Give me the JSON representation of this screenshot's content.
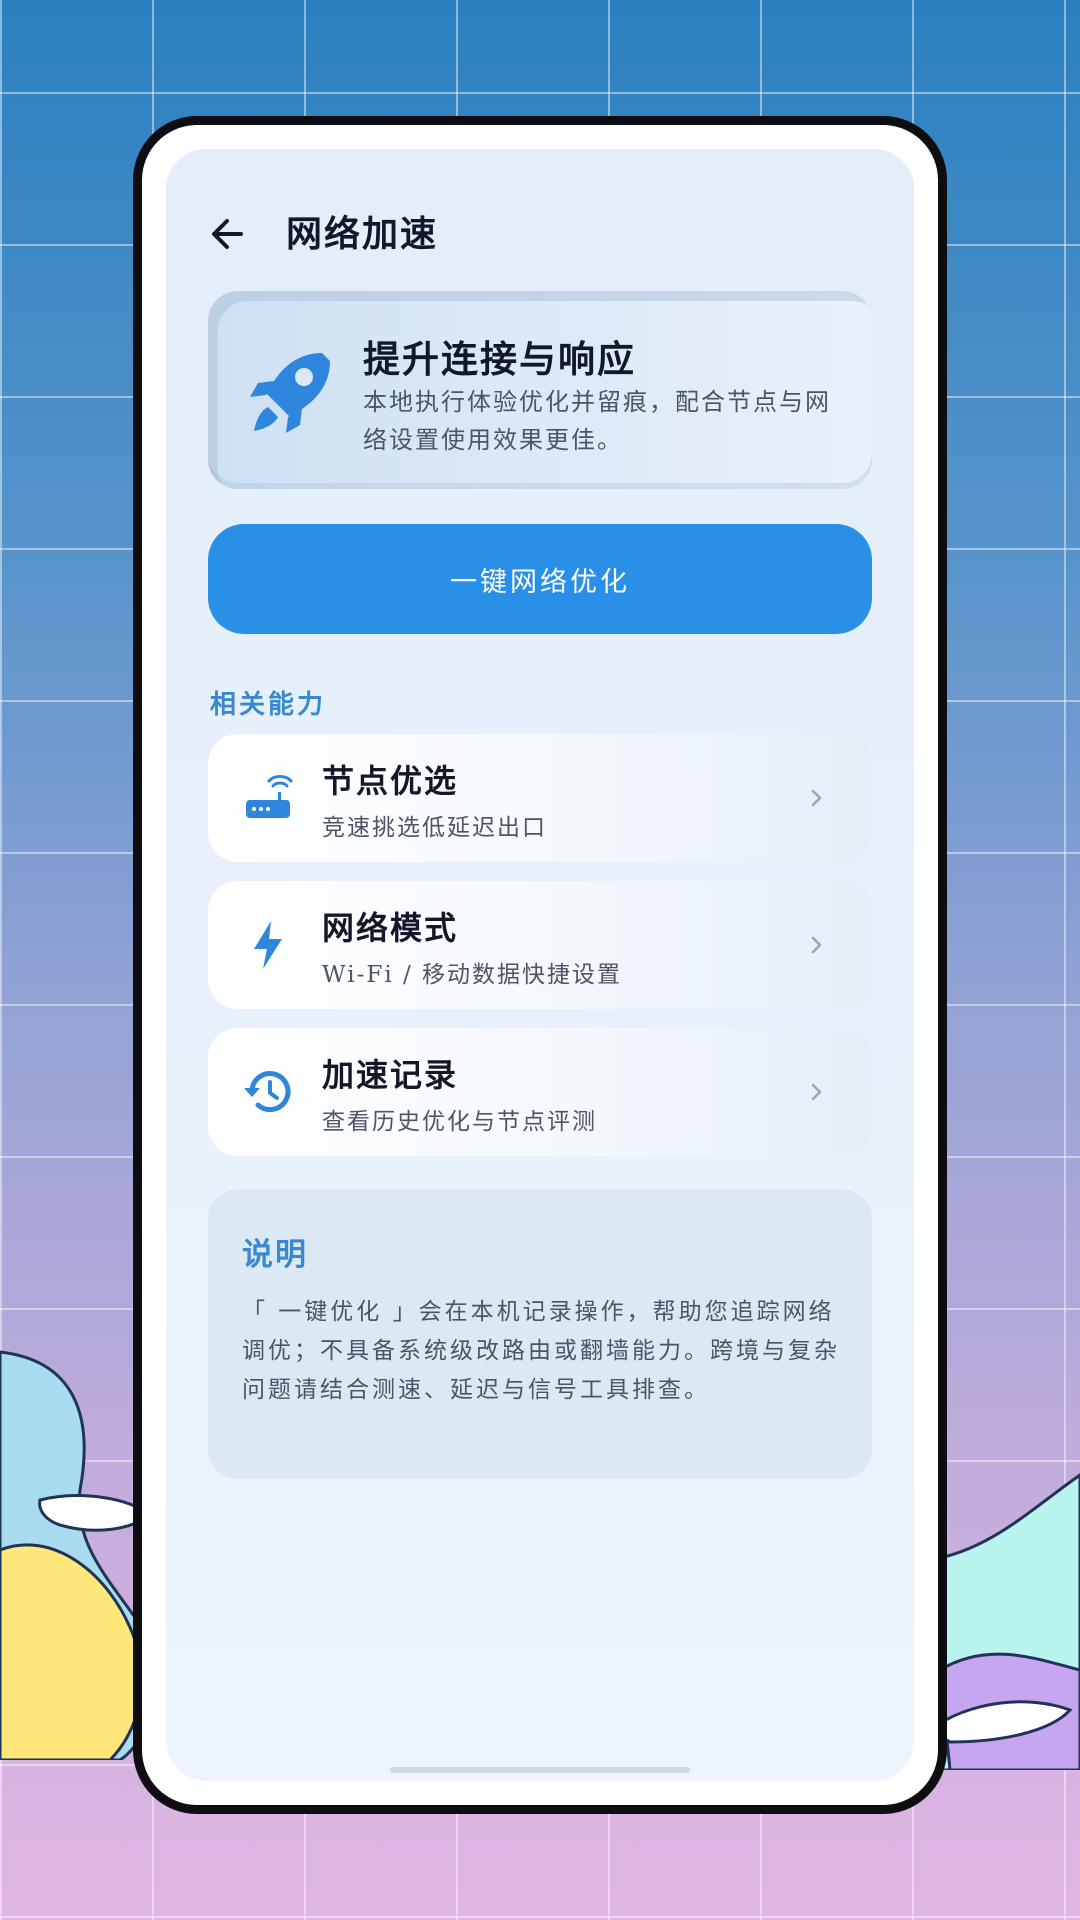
{
  "header": {
    "title": "网络加速",
    "back_icon": "arrow-left-icon"
  },
  "hero": {
    "icon": "rocket-icon",
    "title": "提升连接与响应",
    "description": "本地执行体验优化并留痕，配合节点与网络设置使用效果更佳。"
  },
  "primary_button": {
    "label": "一键网络优化"
  },
  "section": {
    "label": "相关能力"
  },
  "items": [
    {
      "icon": "router-wifi-icon",
      "title": "节点优选",
      "subtitle": "竞速挑选低延迟出口"
    },
    {
      "icon": "lightning-icon",
      "title": "网络模式",
      "subtitle": "Wi-Fi / 移动数据快捷设置"
    },
    {
      "icon": "history-clock-icon",
      "title": "加速记录",
      "subtitle": "查看历史优化与节点评测"
    }
  ],
  "note": {
    "title": "说明",
    "body": "「 一键优化 」会在本机记录操作，帮助您追踪网络调优；不具备系统级改路由或翻墙能力。跨境与复杂问题请结合测速、延迟与信号工具排查。"
  },
  "colors": {
    "accent": "#2a8fe6",
    "section_label": "#3a88cf",
    "icon": "#2f86dd"
  }
}
